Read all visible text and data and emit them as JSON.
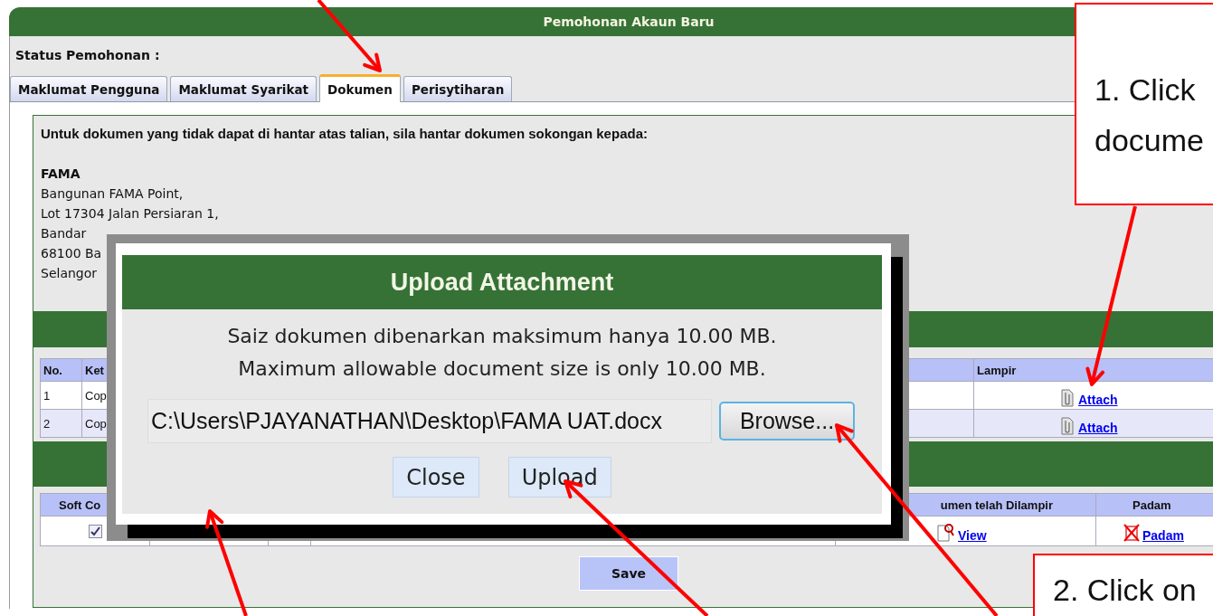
{
  "panel": {
    "title": "Pemohonan Akaun Baru",
    "status_label": "Status Pemohonan :"
  },
  "tabs": [
    {
      "label": "Maklumat Pengguna",
      "selected": false
    },
    {
      "label": "Maklumat Syarikat",
      "selected": false
    },
    {
      "label": "Dokumen",
      "selected": true
    },
    {
      "label": "Perisytiharan",
      "selected": false
    }
  ],
  "notice": {
    "text": "Untuk dokumen yang tidak dapat di hantar atas talian, sila hantar dokumen sokongan kepada:",
    "organisation": "FAMA",
    "address_lines": [
      "Bangunan FAMA Point,",
      "Lot 17304 Jalan Persiaran 1,",
      "Bandar",
      "68100 Ba",
      "Selangor"
    ]
  },
  "attachments_table": {
    "columns": [
      "No.",
      "Ket",
      "Lampir"
    ],
    "rows": [
      {
        "no": "1",
        "description": "Cop",
        "link": "Attach"
      },
      {
        "no": "2",
        "description": "Cop",
        "link": "Attach"
      }
    ]
  },
  "uploaded_table": {
    "columns": [
      "Soft Co",
      "umen telah Dilampir",
      "Padam"
    ],
    "rows": [
      {
        "soft_copy_checked": true,
        "view_link": "View",
        "delete_link": "Padam"
      }
    ]
  },
  "save_button": "Save",
  "dialog": {
    "title": "Upload Attachment",
    "message_lines": [
      "Saiz dokumen dibenarkan maksimum hanya 10.00 MB.",
      "Maximum allowable document size is only 10.00 MB."
    ],
    "file_path": "C:\\Users\\PJAYANATHAN\\Desktop\\FAMA UAT.docx",
    "browse_button": "Browse...",
    "buttons": [
      "Close",
      "Upload"
    ]
  },
  "callouts": [
    {
      "lines": [
        "1. Click",
        "docume"
      ]
    },
    {
      "lines": [
        "2. Click on"
      ]
    }
  ]
}
